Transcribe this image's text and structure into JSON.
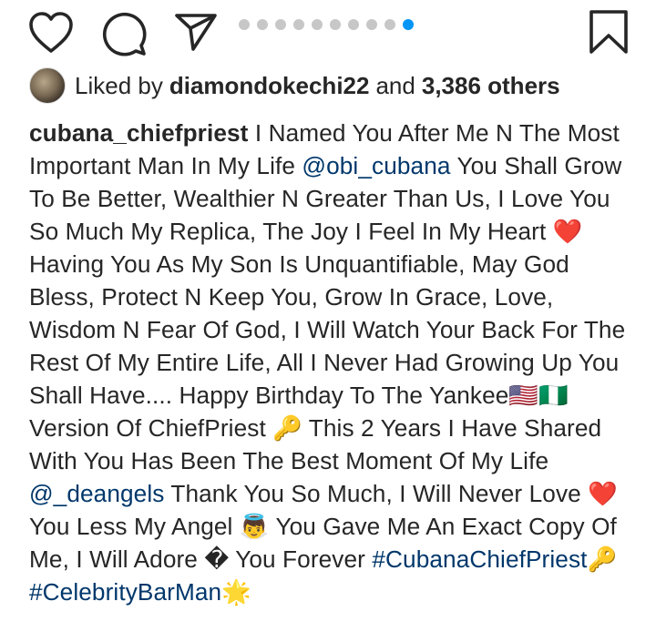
{
  "actions": {
    "like_icon": "heart-outline-icon",
    "comment_icon": "speech-bubble-icon",
    "share_icon": "paper-plane-icon",
    "save_icon": "bookmark-icon",
    "carousel": {
      "count": 10,
      "active_index": 9
    },
    "colors": {
      "dot": "#c7c7c7",
      "dot_active": "#0095f6"
    }
  },
  "likes": {
    "prefix": "Liked by",
    "user": "diamondokechi22",
    "conjunction": "and",
    "others": "3,386 others"
  },
  "caption": {
    "username": "cubana_chiefpriest",
    "segments": [
      {
        "type": "text",
        "text": " I Named You After Me N The Most Important Man In My Life "
      },
      {
        "type": "mention",
        "text": "@obi_cubana"
      },
      {
        "type": "text",
        "text": " You Shall Grow To Be Better, Wealthier N Greater Than Us, I Love You So Much My Replica, The Joy I Feel In My Heart ❤️ Having You As My Son Is Unquantifiable, May God Bless, Protect N Keep You, Grow In Grace, Love, Wisdom N Fear Of God, I Will Watch Your Back For The Rest Of My Entire Life, All I Never Had Growing Up You Shall Have.... Happy Birthday To The Yankee🇺🇸🇳🇬 Version Of ChiefPriest 🔑 This 2 Years I Have Shared With You Has Been The Best Moment Of My Life "
      },
      {
        "type": "mention",
        "text": "@_deangels"
      },
      {
        "type": "text",
        "text": " Thank You So Much, I Will Never Love ❤️ You Less My Angel 👼 You Gave Me An Exact Copy Of Me, I Will Adore � You Forever "
      },
      {
        "type": "tag",
        "text": "#CubanaChiefPriest"
      },
      {
        "type": "text",
        "text": "🔑 "
      },
      {
        "type": "tag",
        "text": "#CelebrityBarMan"
      },
      {
        "type": "text",
        "text": "🌟"
      }
    ]
  }
}
